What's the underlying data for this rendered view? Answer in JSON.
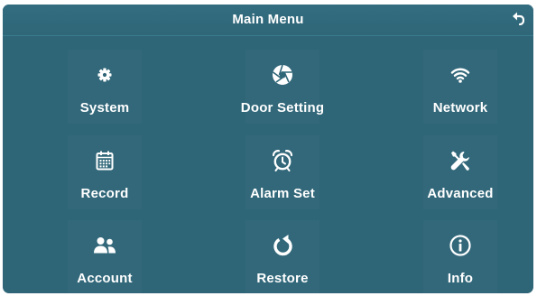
{
  "header": {
    "title": "Main Menu"
  },
  "menu": {
    "items": [
      {
        "label": "System",
        "icon": "gear-icon"
      },
      {
        "label": "Door Setting",
        "icon": "aperture-icon"
      },
      {
        "label": "Network",
        "icon": "wifi-icon"
      },
      {
        "label": "Record",
        "icon": "calendar-icon"
      },
      {
        "label": "Alarm Set",
        "icon": "alarm-clock-icon"
      },
      {
        "label": "Advanced",
        "icon": "tools-icon"
      },
      {
        "label": "Account",
        "icon": "users-icon"
      },
      {
        "label": "Restore",
        "icon": "restore-icon"
      },
      {
        "label": "Info",
        "icon": "info-icon"
      }
    ]
  },
  "colors": {
    "background": "#2e6577",
    "text": "#ffffff"
  }
}
